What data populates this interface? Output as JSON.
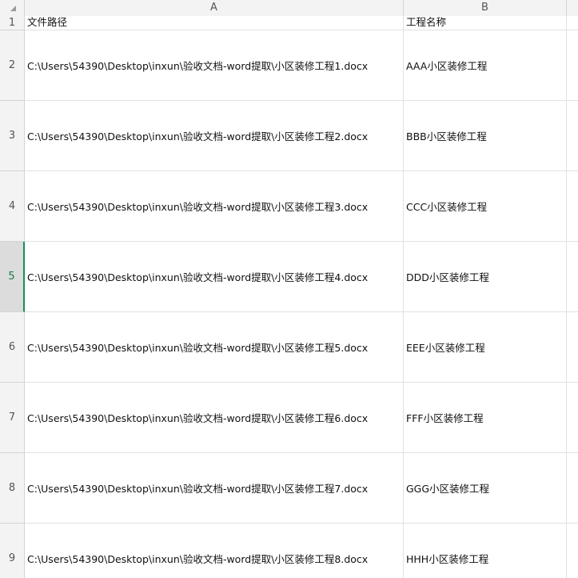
{
  "columns": [
    "A",
    "B"
  ],
  "header_row": {
    "number": "1",
    "path_label": "文件路径",
    "name_label": "工程名称"
  },
  "rows": [
    {
      "number": "2",
      "path": "C:\\Users\\54390\\Desktop\\inxun\\验收文档-word提取\\小区装修工程1.docx",
      "name": "AAA小区装修工程"
    },
    {
      "number": "3",
      "path": "C:\\Users\\54390\\Desktop\\inxun\\验收文档-word提取\\小区装修工程2.docx",
      "name": "BBB小区装修工程"
    },
    {
      "number": "4",
      "path": "C:\\Users\\54390\\Desktop\\inxun\\验收文档-word提取\\小区装修工程3.docx",
      "name": "CCC小区装修工程"
    },
    {
      "number": "5",
      "path": "C:\\Users\\54390\\Desktop\\inxun\\验收文档-word提取\\小区装修工程4.docx",
      "name": "DDD小区装修工程"
    },
    {
      "number": "6",
      "path": "C:\\Users\\54390\\Desktop\\inxun\\验收文档-word提取\\小区装修工程5.docx",
      "name": "EEE小区装修工程"
    },
    {
      "number": "7",
      "path": "C:\\Users\\54390\\Desktop\\inxun\\验收文档-word提取\\小区装修工程6.docx",
      "name": "FFF小区装修工程"
    },
    {
      "number": "8",
      "path": "C:\\Users\\54390\\Desktop\\inxun\\验收文档-word提取\\小区装修工程7.docx",
      "name": "GGG小区装修工程"
    },
    {
      "number": "9",
      "path": "C:\\Users\\54390\\Desktop\\inxun\\验收文档-word提取\\小区装修工程8.docx",
      "name": "HHH小区装修工程"
    }
  ],
  "selected_row": "5",
  "colors": {
    "header_bg": "#f3f3f3",
    "selected_accent": "#1f8a5a",
    "gridline": "#e1e1e1"
  }
}
